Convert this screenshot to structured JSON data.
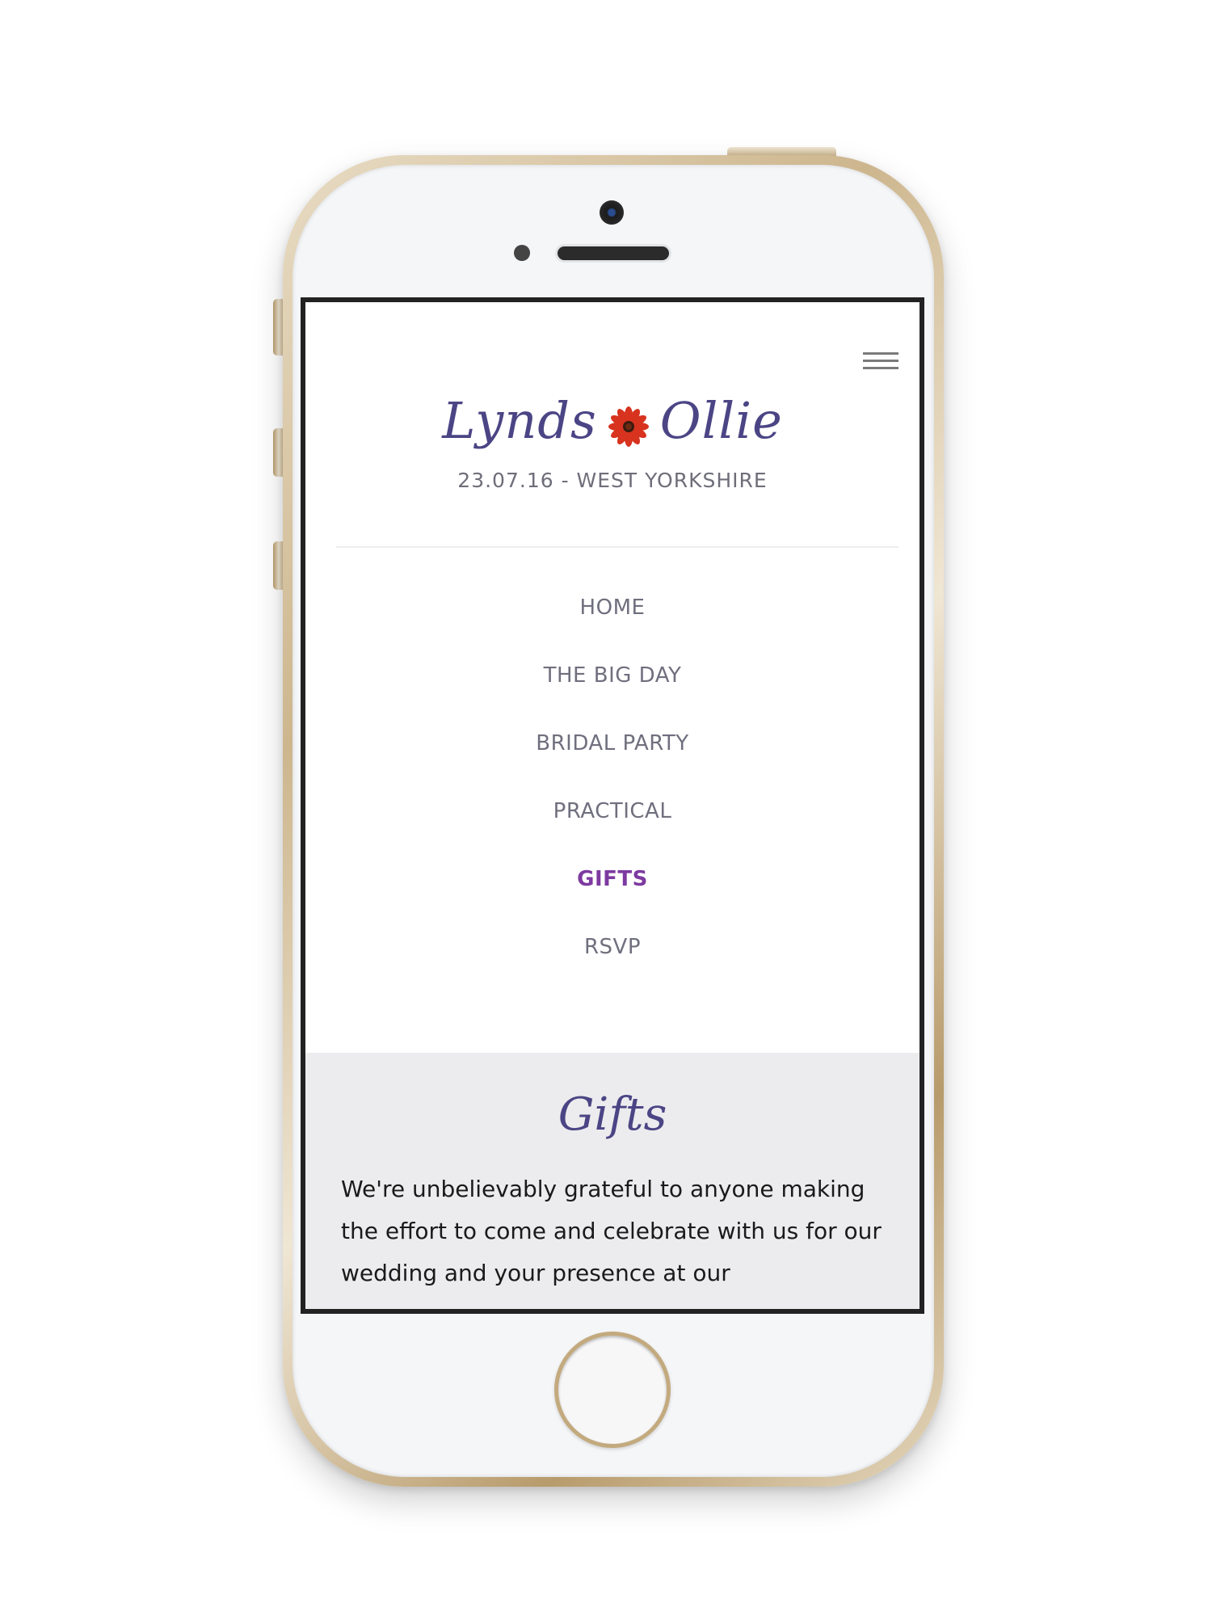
{
  "header": {
    "name_left": "Lynds",
    "name_right": "Ollie",
    "tagline": "23.07.16 - WEST YORKSHIRE"
  },
  "nav": {
    "items": [
      {
        "label": "HOME"
      },
      {
        "label": "THE BIG DAY"
      },
      {
        "label": "BRIDAL PARTY"
      },
      {
        "label": "PRACTICAL"
      },
      {
        "label": "GIFTS"
      },
      {
        "label": "RSVP"
      }
    ],
    "active": "GIFTS"
  },
  "content": {
    "title": "Gifts",
    "text": "We're unbelievably grateful to anyone making the effort to come and celebrate with us for our wedding and your presence at our"
  },
  "colors": {
    "accent": "#4b4585",
    "active_nav": "#7d3aa0",
    "nav_text": "#6f6f7e",
    "content_bg": "#ececee"
  },
  "icons": {
    "menu": "hamburger-icon",
    "flower": "gerbera-flower-icon"
  }
}
